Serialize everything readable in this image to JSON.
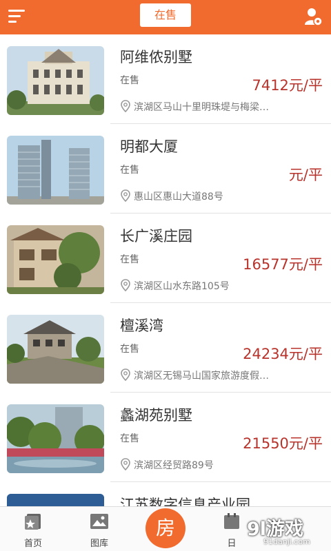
{
  "header": {
    "title": "在售",
    "menu_icon": "menu-icon",
    "user_icon": "user-settings-icon",
    "accent": "#f26b2e"
  },
  "listings": [
    {
      "name": "阿维侬别墅",
      "status": "在售",
      "price": "7412元/平",
      "address": "滨湖区马山十里明珠堤与梅梁…"
    },
    {
      "name": "明都大厦",
      "status": "在售",
      "price": "元/平",
      "address": "惠山区惠山大道88号"
    },
    {
      "name": "长广溪庄园",
      "status": "在售",
      "price": "16577元/平",
      "address": "滨湖区山水东路105号"
    },
    {
      "name": "檀溪湾",
      "status": "在售",
      "price": "24234元/平",
      "address": "滨湖区无锡马山国家旅游度假…"
    },
    {
      "name": "蠡湖苑别墅",
      "status": "在售",
      "price": "21550元/平",
      "address": "滨湖区经贸路89号"
    },
    {
      "name": "江苏数字信息产业园",
      "status": "",
      "price": "",
      "address": ""
    }
  ],
  "tabbar": {
    "home": "首页",
    "gallery": "图库",
    "center": "房",
    "fourth": "日"
  },
  "watermark": {
    "brand": "9l游戏",
    "url": "91danji.com"
  },
  "colors": {
    "price": "#b7332b",
    "tabbar_bg": "#fafafa"
  }
}
